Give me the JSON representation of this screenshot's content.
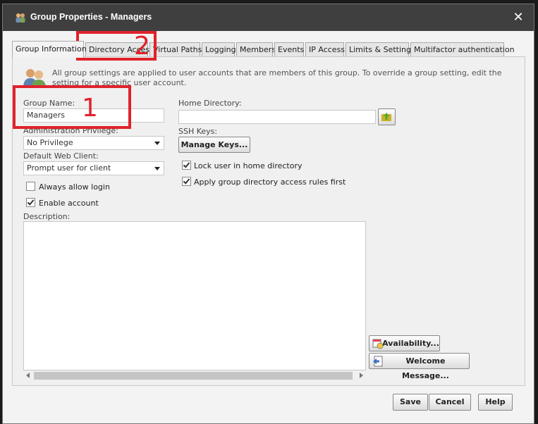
{
  "dialog": {
    "title": "Group Properties - Managers",
    "close_label": "✕"
  },
  "tabs": [
    {
      "label": "Group Information",
      "active": true
    },
    {
      "label": "Directory Access",
      "active": false
    },
    {
      "label": "Virtual Paths",
      "active": false
    },
    {
      "label": "Logging",
      "active": false
    },
    {
      "label": "Members",
      "active": false
    },
    {
      "label": "Events",
      "active": false
    },
    {
      "label": "IP Access",
      "active": false
    },
    {
      "label": "Limits & Settings",
      "active": false
    },
    {
      "label": "Multifactor authentication",
      "active": false
    }
  ],
  "group_info": {
    "intro_text": "All group settings are applied to user accounts that are members of this group. To override a group setting, edit the setting for a specific user account.",
    "group_name_label": "Group Name:",
    "group_name_value": "Managers",
    "admin_privilege_label": "Administration Privilege:",
    "admin_privilege_value": "No Privilege",
    "default_web_client_label": "Default Web Client:",
    "default_web_client_value": "Prompt user for client",
    "always_allow_login_label": "Always allow login",
    "always_allow_login_checked": false,
    "enable_account_label": "Enable account",
    "enable_account_checked": true,
    "description_label": "Description:",
    "description_value": "",
    "home_directory_label": "Home Directory:",
    "home_directory_value": "",
    "ssh_keys_label": "SSH Keys:",
    "manage_keys_label": "Manage Keys...",
    "lock_home_label": "Lock user in home directory",
    "lock_home_checked": true,
    "apply_rules_label": "Apply group directory access rules first",
    "apply_rules_checked": true,
    "availability_label": "Availability...",
    "welcome_message_label": "Welcome Message..."
  },
  "footer": {
    "save_label": "Save",
    "cancel_label": "Cancel",
    "help_label": "Help"
  },
  "annotations": [
    {
      "number": "1"
    },
    {
      "number": "2"
    }
  ],
  "colors": {
    "titlebar": "#3f3f3f",
    "annotation": "#e0222b",
    "panel": "#f0f0f0"
  }
}
